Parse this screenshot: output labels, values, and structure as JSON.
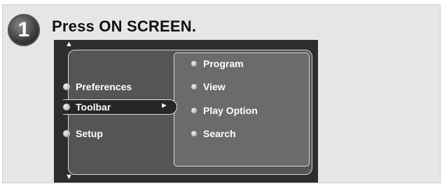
{
  "step": {
    "number": "1"
  },
  "instruction": "Press ON SCREEN.",
  "screen": {
    "scroll_up_glyph": "▲",
    "scroll_down_glyph": "▼",
    "left_menu": [
      {
        "label": "Preferences"
      },
      {
        "label": "Toolbar",
        "selected": true
      },
      {
        "label": "Setup"
      }
    ],
    "selected_arrow_glyph": "►",
    "right_menu": [
      {
        "label": "Program"
      },
      {
        "label": "View"
      },
      {
        "label": "Play Option"
      },
      {
        "label": "Search"
      }
    ]
  },
  "colors": {
    "panel_bg": "#e6e6e6",
    "screen_bg": "#2d2d2d",
    "menu_bg": "#555555",
    "submenu_bg": "#6b6b6b"
  }
}
